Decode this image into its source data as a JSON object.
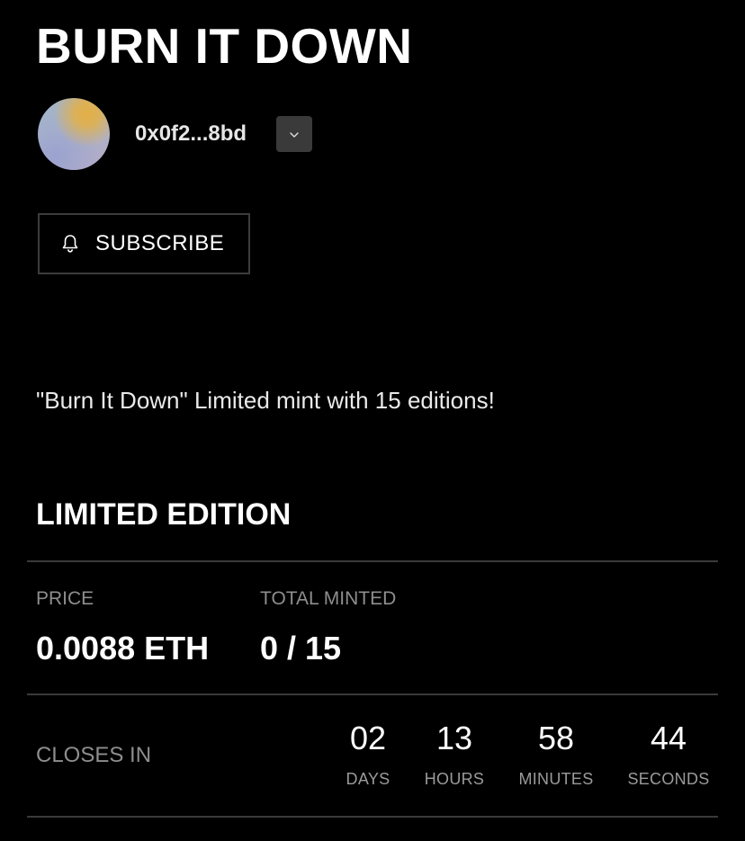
{
  "title": "BURN IT DOWN",
  "creator": {
    "address": "0x0f2...8bd",
    "avatar_colors": [
      "#e4b046",
      "#9fb3c8",
      "#b7a9c7"
    ]
  },
  "subscribe": {
    "label": "SUBSCRIBE",
    "icon": "bell-icon"
  },
  "description": "\"Burn It Down\" Limited mint with 15 editions!",
  "edition": {
    "section_title": "LIMITED EDITION",
    "price_label": "PRICE",
    "price_value": "0.0088 ETH",
    "minted_label": "TOTAL MINTED",
    "minted_value": "0 / 15"
  },
  "countdown": {
    "label": "CLOSES IN",
    "units": [
      {
        "value": "02",
        "label": "DAYS"
      },
      {
        "value": "13",
        "label": "HOURS"
      },
      {
        "value": "58",
        "label": "MINUTES"
      },
      {
        "value": "44",
        "label": "SECONDS"
      }
    ]
  },
  "colors": {
    "background": "#000000",
    "text": "#ffffff",
    "muted": "#8e8e8e",
    "divider": "#3a3a3a"
  }
}
